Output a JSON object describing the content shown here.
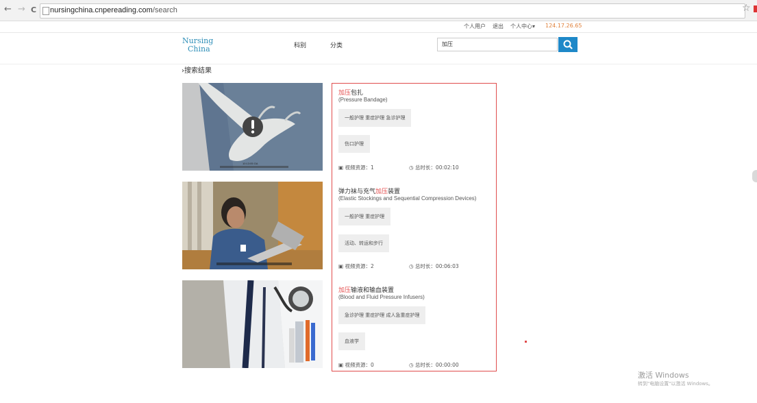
{
  "browser": {
    "back": "←",
    "forward": "→",
    "reload": "C",
    "url_domain": "nursingchina.cnpereading.com",
    "url_path": "/search"
  },
  "user_bar": {
    "personal_user": "个人用户",
    "logout": "退出",
    "personal_center": "个人中心▾",
    "ip": "124.17.26.65",
    "ip_color": "#e0803a"
  },
  "header": {
    "logo_line1": "Nursing",
    "logo_line2": "China",
    "nav_department": "科别",
    "nav_category": "分类",
    "search_value": "加压",
    "accent_color": "#1e88c8"
  },
  "breadcrumb": "搜索结果",
  "results": [
    {
      "title_hl": "加压",
      "title_rest": "包扎",
      "title_pre": "",
      "subtitle": "(Pressure Bandage)",
      "tags_row1": "一般护理  重症护理  急诊护理",
      "tags_row2": "伤口护理",
      "video_label": "视频资源：1",
      "duration_label": "总时长：00:02:10"
    },
    {
      "title_pre": "弹力袜与充气",
      "title_hl": "加压",
      "title_rest": "装置",
      "subtitle": "(Elastic Stockings and Sequential Compression Devices)",
      "tags_row1": "一般护理  重症护理",
      "tags_row2": "活动、转运和步行",
      "video_label": "视频资源：2",
      "duration_label": "总时长：00:06:03"
    },
    {
      "title_pre": "",
      "title_hl": "加压",
      "title_rest": "输液和输血装置",
      "subtitle": "(Blood and Fluid Pressure Infusers)",
      "tags_row1": "急诊护理  重症护理  成人急重症护理",
      "tags_row2": "血液学",
      "video_label": "视频资源：0",
      "duration_label": "总时长：00:00:00"
    }
  ],
  "watermark": {
    "line1": "激活 Windows",
    "line2": "转到\"电脑设置\"以激活 Windows。"
  },
  "icons": [
    "page-icon",
    "star-icon",
    "search-icon",
    "video-icon",
    "clock-icon",
    "alert-icon"
  ]
}
